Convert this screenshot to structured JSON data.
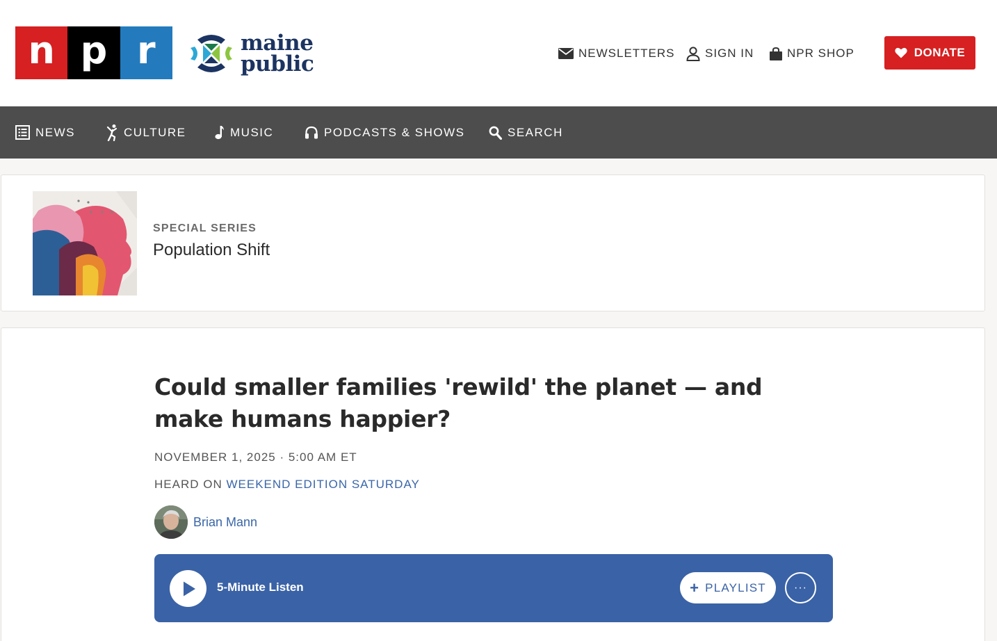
{
  "header": {
    "npr_logo_letters": [
      "n",
      "p",
      "r"
    ],
    "station_logo_line1": "maine",
    "station_logo_line2": "public",
    "utility_nav": [
      {
        "label": "NEWSLETTERS",
        "icon": "mail-icon"
      },
      {
        "label": "SIGN IN",
        "icon": "user-icon"
      },
      {
        "label": "NPR SHOP",
        "icon": "shopping-bag-icon"
      }
    ],
    "donate_label": "DONATE"
  },
  "main_nav": {
    "items": [
      {
        "label": "NEWS",
        "icon": "news-icon"
      },
      {
        "label": "CULTURE",
        "icon": "culture-icon"
      },
      {
        "label": "MUSIC",
        "icon": "music-note-icon"
      },
      {
        "label": "PODCASTS & SHOWS",
        "icon": "headphones-icon"
      },
      {
        "label": "SEARCH",
        "icon": "search-icon"
      }
    ]
  },
  "series": {
    "kicker": "SPECIAL SERIES",
    "title": "Population Shift"
  },
  "article": {
    "headline": "Could smaller families 'rewild' the planet — and make humans happier?",
    "dateline": "NOVEMBER 1, 2025 · 5:00 AM ET",
    "heard_on_prefix": "HEARD ON",
    "heard_on_program": "WEEKEND EDITION SATURDAY",
    "author": "Brian Mann"
  },
  "player": {
    "listen_label": "5-Minute Listen",
    "playlist_label": "PLAYLIST",
    "more_label": "···"
  },
  "colors": {
    "npr_red": "#d62021",
    "npr_black": "#000000",
    "npr_blue": "#237bbd",
    "nav_bg": "#4d4d4d",
    "player_blue": "#3a62a6",
    "link_blue": "#3a66a8"
  }
}
